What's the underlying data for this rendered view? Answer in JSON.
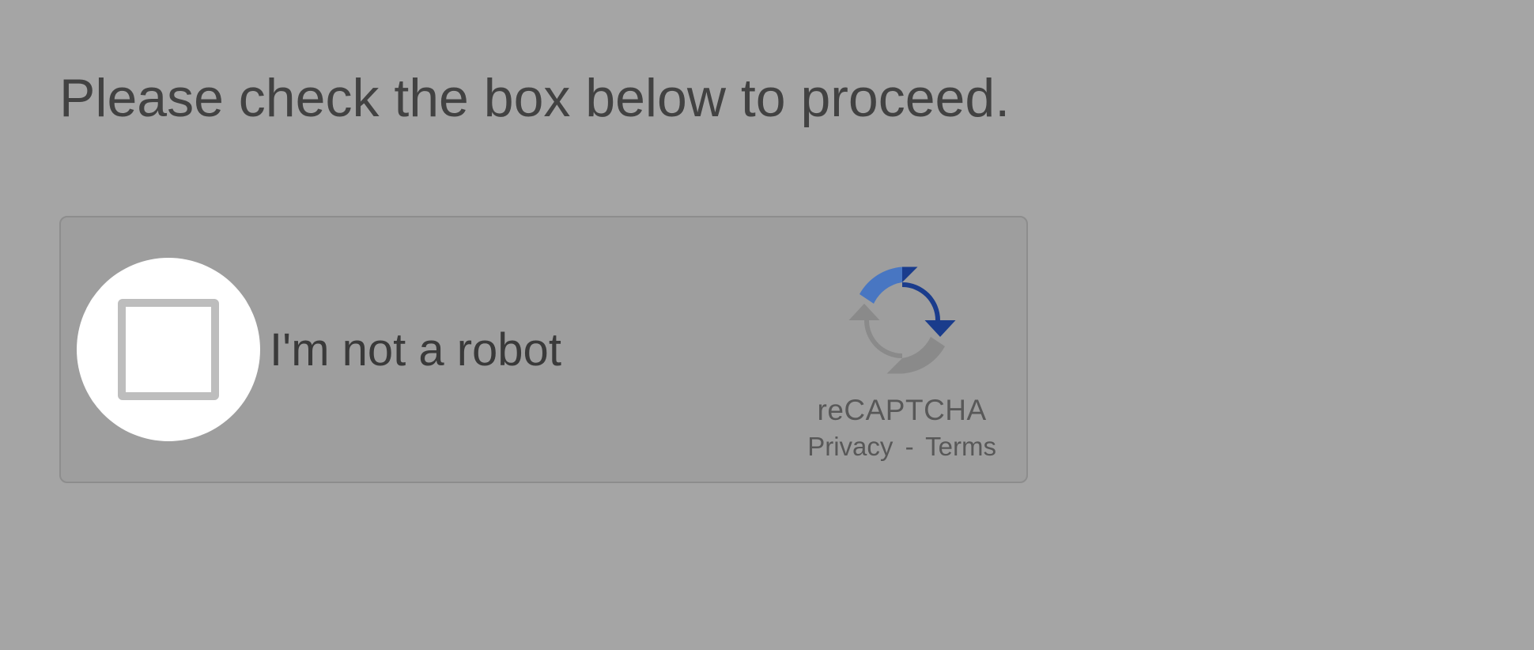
{
  "instruction": "Please check the box below to proceed.",
  "captcha": {
    "label": "I'm not a robot",
    "brand": "reCAPTCHA",
    "privacy": "Privacy",
    "terms": "Terms",
    "separator": "-"
  }
}
